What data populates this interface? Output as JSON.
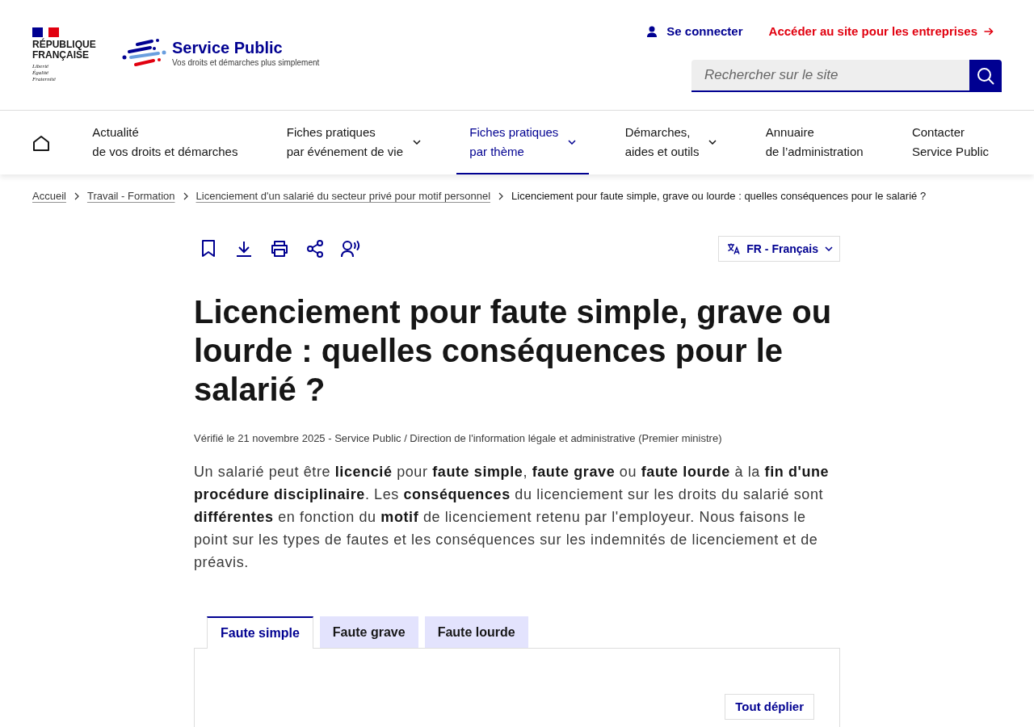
{
  "header": {
    "republic_logo": {
      "name_lines": [
        "RÉPUBLIQUE",
        "FRANÇAISE"
      ],
      "motto": [
        "Liberté",
        "Égalité",
        "Fraternité"
      ]
    },
    "brand": {
      "name": "Service Public",
      "tagline": "Vos droits et démarches plus simplement"
    },
    "links": [
      {
        "label": "Se connecter",
        "kind": "account"
      },
      {
        "label": "Accéder au site pour les entreprises",
        "kind": "external"
      }
    ],
    "search": {
      "placeholder": "Rechercher sur le site"
    }
  },
  "nav": {
    "items": [
      {
        "lines": [
          "Actualité",
          "de vos droits et démarches"
        ],
        "has_menu": false,
        "selected": false
      },
      {
        "lines": [
          "Fiches pratiques",
          "par événement de vie"
        ],
        "has_menu": true,
        "selected": false
      },
      {
        "lines": [
          "Fiches pratiques",
          "par thème"
        ],
        "has_menu": true,
        "selected": true
      },
      {
        "lines": [
          "Démarches,",
          "aides et outils"
        ],
        "has_menu": true,
        "selected": false
      },
      {
        "lines": [
          "Annuaire",
          "de l’administration"
        ],
        "has_menu": false,
        "selected": false
      },
      {
        "lines": [
          "Contacter",
          "Service Public"
        ],
        "has_menu": false,
        "selected": false
      }
    ]
  },
  "breadcrumb": [
    {
      "label": "Accueil",
      "current": false
    },
    {
      "label": "Travail - Formation",
      "current": false
    },
    {
      "label": "Licenciement d'un salarié du secteur privé pour motif personnel",
      "current": false
    },
    {
      "label": "Licenciement pour faute simple, grave ou lourde : quelles conséquences pour le salarié ?",
      "current": true
    }
  ],
  "language": {
    "label": "FR - Français"
  },
  "title": "Licenciement pour faute simple, grave ou lourde : quelles conséquences pour le salarié ?",
  "meta": "Vérifié le 21 novembre 2025 - Service Public / Direction de l'information légale et administrative (Premier ministre)",
  "intro": "Un salarié peut être **licencié** pour **faute simple**, **faute grave** ou **faute lourde** à la **fin d'une procédure disciplinaire**. Les **conséquences** du licenciement sur les droits du salarié sont **différentes** en fonction du **motif** de licenciement retenu par l'employeur. Nous faisons le point sur les types de fautes et les conséquences sur les indemnités de licenciement et de préavis.",
  "tabs": [
    {
      "label": "Faute simple",
      "selected": true
    },
    {
      "label": "Faute grave",
      "selected": false
    },
    {
      "label": "Faute lourde",
      "selected": false
    }
  ],
  "expand_all": {
    "label": "Tout déplier"
  }
}
